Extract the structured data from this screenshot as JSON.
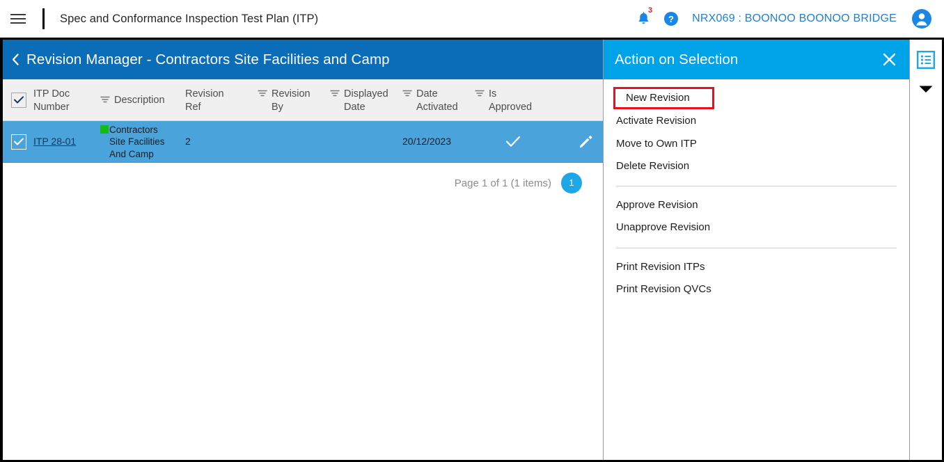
{
  "topbar": {
    "menu_icon": "hamburger-icon",
    "app_title": "Spec and Conformance  Inspection Test Plan (ITP)",
    "notification_icon": "bell-icon",
    "notification_count": "3",
    "help_icon": "help-circle-icon",
    "project_name": "NRX069 : BOONOO BOONOO BRIDGE",
    "avatar_icon": "user-avatar-icon"
  },
  "left_pane": {
    "back_icon": "chevron-left-icon",
    "title": "Revision Manager - Contractors Site Facilities and Camp",
    "columns": [
      {
        "label": "ITP Doc\nNumber",
        "filter": false
      },
      {
        "label": "Description",
        "filter": true
      },
      {
        "label": "Revision\nRef",
        "filter": false
      },
      {
        "label": "Revision\nBy",
        "filter": true
      },
      {
        "label": "Displayed\nDate",
        "filter": true
      },
      {
        "label": "Date\nActivated",
        "filter": true
      },
      {
        "label": "Is\nApproved",
        "filter": true
      }
    ],
    "rows": [
      {
        "selected": true,
        "doc_number": "ITP 28-01",
        "status_color": "#14bb14",
        "description": "Contractors\nSite Facilities\nAnd Camp",
        "revision_ref": "2",
        "revision_by": "",
        "displayed_date": "",
        "date_activated": "20/12/2023",
        "is_approved": "✓",
        "edit_icon": "pencil-icon"
      }
    ],
    "pager": {
      "text": "Page 1 of 1 (1 items)",
      "current_page": "1"
    }
  },
  "action_panel": {
    "title": "Action on Selection",
    "close_icon": "close-icon",
    "groups": [
      {
        "items": [
          {
            "label": "New Revision",
            "highlighted": true
          },
          {
            "label": "Activate Revision",
            "highlighted": false
          },
          {
            "label": "Move to Own ITP",
            "highlighted": false
          },
          {
            "label": "Delete Revision",
            "highlighted": false
          }
        ]
      },
      {
        "items": [
          {
            "label": "Approve Revision",
            "highlighted": false
          },
          {
            "label": "Unapprove Revision",
            "highlighted": false
          }
        ]
      },
      {
        "items": [
          {
            "label": "Print Revision ITPs",
            "highlighted": false
          },
          {
            "label": "Print Revision QVCs",
            "highlighted": false
          }
        ]
      }
    ],
    "highlight_color": "#e4131e"
  },
  "rail": {
    "list_icon": "list-view-icon",
    "chevron_icon": "chevron-down-icon"
  },
  "colors": {
    "header_blue": "#0b6cb8",
    "panel_blue": "#00a2e8",
    "row_blue": "#4ba3db",
    "link_blue": "#1f7fd6"
  }
}
